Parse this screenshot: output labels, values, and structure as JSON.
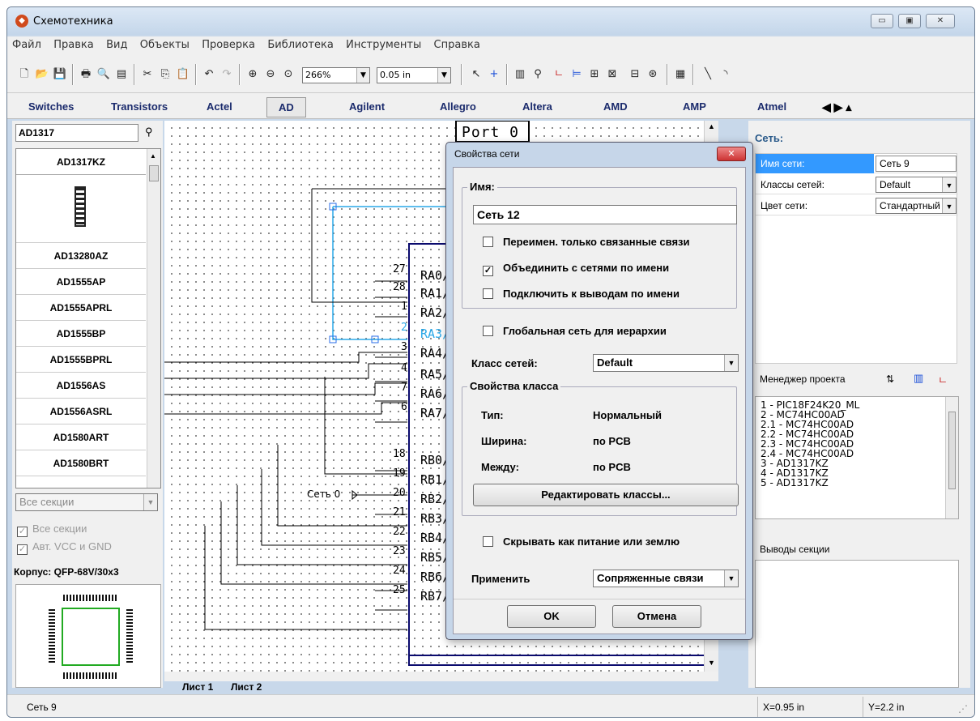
{
  "window": {
    "title": "Схемотехника",
    "minimize": "▭",
    "maximize": "▣",
    "close": "✕"
  },
  "menu": [
    "Файл",
    "Правка",
    "Вид",
    "Объекты",
    "Проверка",
    "Библиотека",
    "Инструменты",
    "Справка"
  ],
  "toolbar": {
    "zoom": "266%",
    "grid": "0.05 in"
  },
  "library_tabs": [
    "Switches",
    "Transistors",
    "Actel",
    "AD",
    "Agilent",
    "Allegro",
    "Altera",
    "AMD",
    "AMP",
    "Atmel"
  ],
  "left": {
    "search": "AD1317",
    "parts": [
      "AD1317KZ",
      "AD13280AZ",
      "AD1555AP",
      "AD1555APRL",
      "AD1555BP",
      "AD1555BPRL",
      "AD1556AS",
      "AD1556ASRL",
      "AD1580ART",
      "AD1580BRT"
    ],
    "sections": "Все секции",
    "chk_all": "Все секции",
    "chk_vcc": "Авт. VCC и GND",
    "package": "Корпус: QFP-68V/30x3"
  },
  "canvas": {
    "port_label": "Port 0",
    "net_label": "Сеть 0",
    "sheet_tabs": [
      "Лист 1",
      "Лист 2"
    ],
    "pins": [
      {
        "num": "27",
        "name": "RA0/"
      },
      {
        "num": "28",
        "name": "RA1/"
      },
      {
        "num": "1",
        "name": "RA2/"
      },
      {
        "num": "2",
        "name": "RA3/"
      },
      {
        "num": "3",
        "name": "RA4/"
      },
      {
        "num": "4",
        "name": "RA5/"
      },
      {
        "num": "7",
        "name": "RA6/"
      },
      {
        "num": "6",
        "name": "RA7/"
      },
      {
        "num": "18",
        "name": "RB0/"
      },
      {
        "num": "19",
        "name": "RB1/"
      },
      {
        "num": "20",
        "name": "RB2/"
      },
      {
        "num": "21",
        "name": "RB3/"
      },
      {
        "num": "22",
        "name": "RB4/"
      },
      {
        "num": "23",
        "name": "RB5/"
      },
      {
        "num": "24",
        "name": "RB6/"
      },
      {
        "num": "25",
        "name": "RB7/"
      }
    ]
  },
  "right": {
    "net_header": "Сеть:",
    "props": [
      {
        "key": "Имя сети:",
        "value": "Сеть 9"
      },
      {
        "key": "Классы сетей:",
        "value": "Default"
      },
      {
        "key": "Цвет сети:",
        "value": "Стандартный"
      }
    ],
    "project_header": "Менеджер проекта",
    "tree": [
      "1 - PIC18F24K20_ML",
      "2 - MC74HC00AD",
      "2.1 - MC74HC00AD",
      "2.2 - MC74HC00AD",
      "2.3 - MC74HC00AD",
      "2.4 - MC74HC00AD",
      "3 - AD1317KZ",
      "4 - AD1317KZ",
      "5 - AD1317KZ"
    ],
    "pins_header": "Выводы секции"
  },
  "status": {
    "text": "Сеть 9",
    "x": "X=0.95 in",
    "y": "Y=2.2 in"
  },
  "dialog": {
    "title": "Свойства сети",
    "name_group": "Имя:",
    "name_value": "Сеть 12",
    "chk_rename": "Переимен. только связанные связи",
    "chk_merge": "Объединить с сетями по имени",
    "chk_connect": "Подключить к выводам по имени",
    "chk_global": "Глобальная сеть для иерархии",
    "class_label": "Класс сетей:",
    "class_value": "Default",
    "class_props_group": "Свойства класса",
    "type_label": "Тип:",
    "type_value": "Нормальный",
    "width_label": "Ширина:",
    "width_value": "по PCB",
    "between_label": "Между:",
    "between_value": "по PCB",
    "edit_classes": "Редактировать классы...",
    "chk_hide": "Скрывать как питание или землю",
    "apply_label": "Применить",
    "apply_value": "Сопряженные связи",
    "ok": "OK",
    "cancel": "Отмена"
  }
}
